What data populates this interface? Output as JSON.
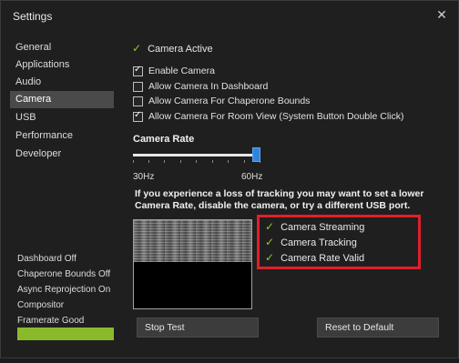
{
  "window": {
    "title": "Settings",
    "close_glyph": "✕"
  },
  "sidebar": {
    "items": [
      {
        "label": "General",
        "active": false
      },
      {
        "label": "Applications",
        "active": false
      },
      {
        "label": "Audio",
        "active": false
      },
      {
        "label": "Camera",
        "active": true
      },
      {
        "label": "USB",
        "active": false
      },
      {
        "label": "Performance",
        "active": false
      },
      {
        "label": "Developer",
        "active": false
      }
    ],
    "status_lines": [
      "Dashboard Off",
      "Chaperone Bounds Off",
      "Async Reprojection On",
      "Compositor",
      "Framerate Good"
    ],
    "status_bar_color": "#8aba2c"
  },
  "camera": {
    "active_label": "Camera Active",
    "options": [
      {
        "label": "Enable Camera",
        "checked": true
      },
      {
        "label": "Allow Camera In Dashboard",
        "checked": false
      },
      {
        "label": "Allow Camera For Chaperone Bounds",
        "checked": false
      },
      {
        "label": "Allow Camera For Room View (System Button Double Click)",
        "checked": true
      }
    ],
    "rate": {
      "title": "Camera Rate",
      "min_label": "30Hz",
      "max_label": "60Hz",
      "value_fraction": 1.0
    },
    "hint": "If you experience a loss of tracking you may want to set a lower Camera Rate, disable the camera, or try a different USB port.",
    "tracking_status": [
      "Camera Streaming",
      "Camera Tracking",
      "Camera Rate Valid"
    ],
    "highlight_color": "#e0202a",
    "check_color": "#8fc93a"
  },
  "buttons": {
    "stop_test": "Stop Test",
    "reset_default": "Reset to Default"
  }
}
